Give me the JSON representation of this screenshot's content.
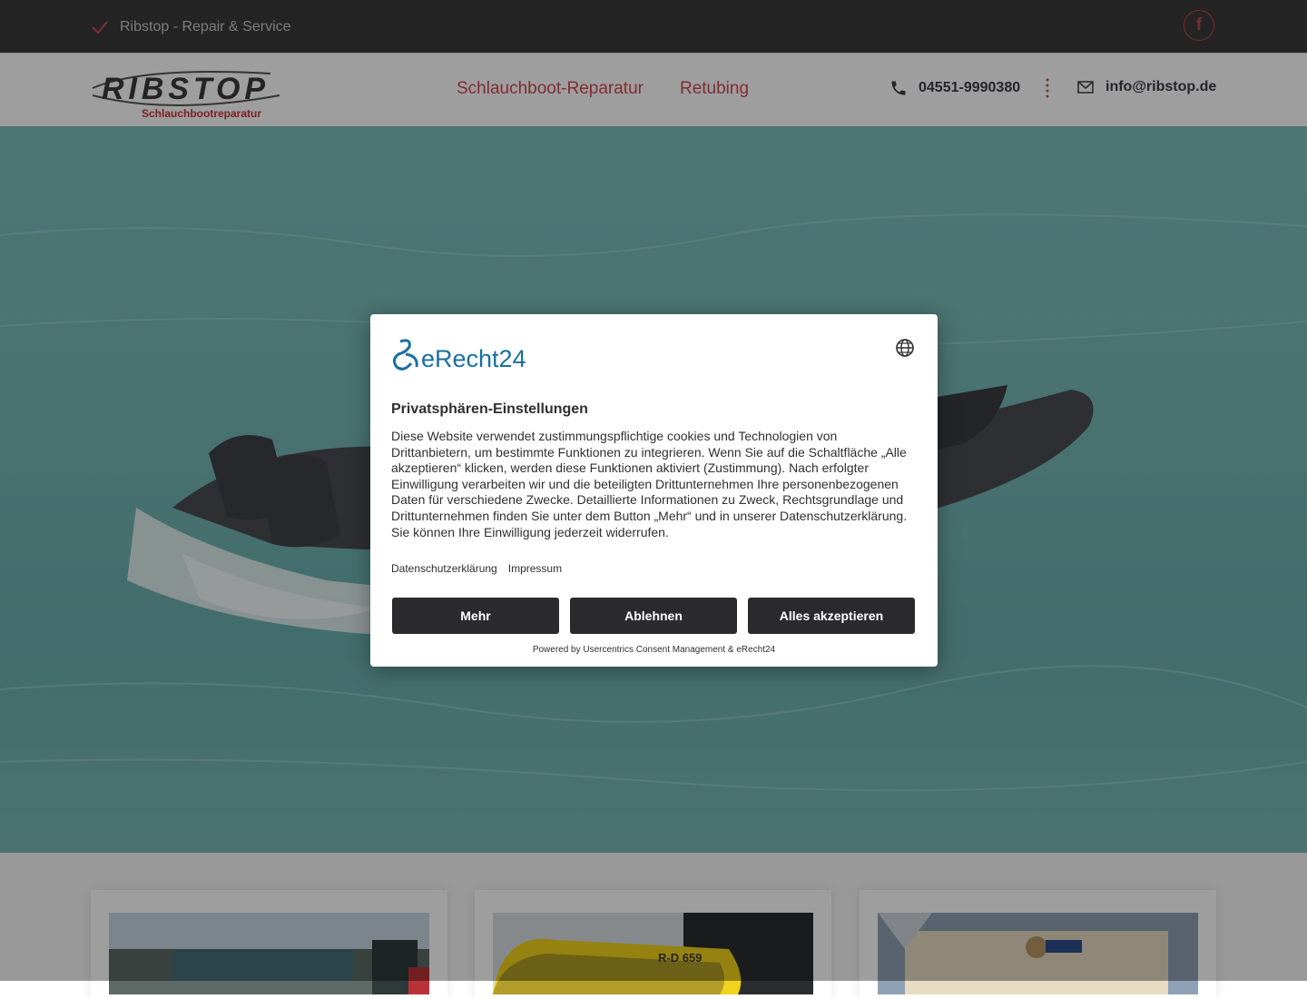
{
  "topbar": {
    "tagline": "Ribstop - Repair & Service",
    "facebook_icon": "f"
  },
  "header": {
    "logo_text": "RIBSTOP",
    "logo_subtitle": "Schlauchbootreparatur",
    "nav": [
      "Schlauchboot-Reparatur",
      "Retubing"
    ],
    "phone": "04551-9990380",
    "email": "info@ribstop.de"
  },
  "cookie_dialog": {
    "brand": "eRecht24",
    "title": "Privatsphären-Einstellungen",
    "body": "Diese Website verwendet zustimmungspflichtige cookies und Technologien von Drittanbietern, um bestimmte Funktionen zu integrieren. Wenn Sie auf die Schaltfläche „Alle akzeptieren“ klicken, werden diese Funktionen aktiviert (Zustimmung). Nach erfolgter Einwilligung verarbeiten wir und die beteiligten Drittunternehmen Ihre personenbezogenen Daten für verschiedene Zwecke. Detaillierte Informationen zu Zweck, Rechtsgrundlage und Drittunternehmen finden Sie unter dem Button „Mehr“ und in unserer Datenschutzerklärung. Sie können Ihre Einwilligung jederzeit widerrufen.",
    "links": [
      "Datenschutzerklärung",
      "Impressum"
    ],
    "buttons": {
      "more": "Mehr",
      "decline": "Ablehnen",
      "accept_all": "Alles akzeptieren"
    },
    "powered_by": "Powered by Usercentrics Consent Management & eRecht24"
  },
  "cards": {
    "boat_registration": "R-D 659"
  },
  "colors": {
    "accent": "#d04a52",
    "topbar": "#3a3a3a",
    "button": "#2b2b2e",
    "brand_blue": "#1a6fa0"
  },
  "icons": [
    "check-icon",
    "facebook-icon",
    "phone-icon",
    "mail-icon",
    "globe-icon"
  ]
}
